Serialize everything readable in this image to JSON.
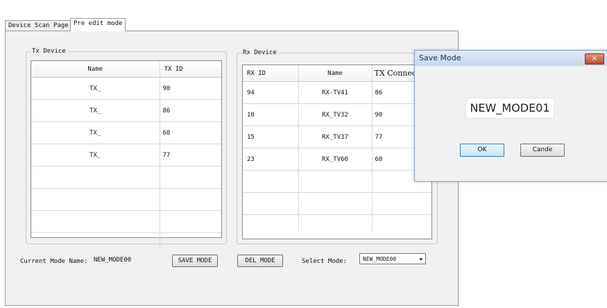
{
  "tabs": [
    "Device Scan Page",
    "Pre edit mode"
  ],
  "tx": {
    "title": "Tx Device",
    "headers": [
      "Name",
      "TX ID"
    ],
    "rows": [
      [
        "TX_",
        "90"
      ],
      [
        "TX_",
        "86"
      ],
      [
        "TX_",
        "60"
      ],
      [
        "TX_",
        "77"
      ]
    ]
  },
  "rx": {
    "title": "Rx Device",
    "headers": [
      "RX ID",
      "Name",
      "TX Connect"
    ],
    "rows": [
      [
        "94",
        "RX-TV41",
        "86"
      ],
      [
        "10",
        "RX_TV32",
        "90"
      ],
      [
        "15",
        "RX_TV37",
        "77"
      ],
      [
        "23",
        "RX_TV60",
        "60"
      ]
    ]
  },
  "bottom": {
    "current_label": "Current Mode Name:",
    "current_value": "NEW_MODE00",
    "save_label": "SAVE MODE",
    "del_label": "DEL MODE",
    "select_label": "Select Mode:",
    "select_value": "NEW_MODE00"
  },
  "dialog": {
    "title": "Save Mode",
    "close": "×",
    "mode_name": "NEW_MODE01",
    "ok": "OK",
    "cancel": "Cande"
  }
}
